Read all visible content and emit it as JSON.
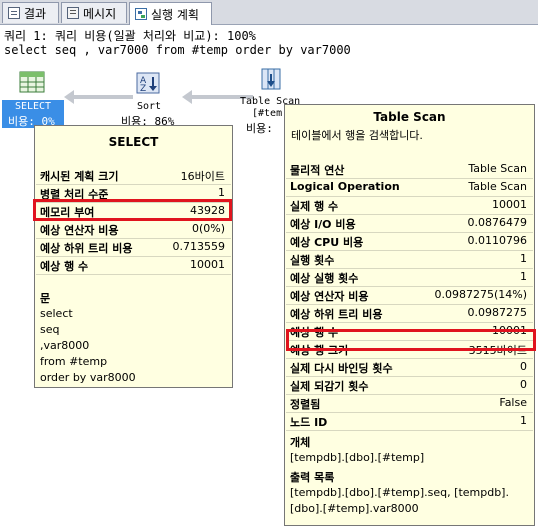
{
  "tabs": [
    {
      "label": "결과",
      "icon": "grid-icon"
    },
    {
      "label": "메시지",
      "icon": "message-icon"
    },
    {
      "label": "실행 계획",
      "icon": "execution-plan-icon"
    }
  ],
  "query": {
    "header": "쿼리 1: 쿼리 비용(일괄 처리와 비교): 100%",
    "sql": "select seq , var7000 from #temp order by var7000"
  },
  "nodes": {
    "select": {
      "label": "SELECT",
      "cost": "비용: 0%",
      "icon": "select-operator-icon"
    },
    "sort": {
      "label": "Sort",
      "cost": "비용: 86%",
      "icon": "sort-operator-icon"
    },
    "scan": {
      "label": "Table Scan",
      "sublabel": "[#tem",
      "cost": "비용: ",
      "icon": "table-scan-operator-icon"
    }
  },
  "select_tooltip": {
    "title": "SELECT",
    "rows": [
      {
        "k": "캐시된 계획 크기",
        "v": "16바이트"
      },
      {
        "k": "병렬 처리 수준",
        "v": "1"
      },
      {
        "k": "메모리 부여",
        "v": "43928"
      },
      {
        "k": "예상 연산자 비용",
        "v": "0(0%)"
      },
      {
        "k": "예상 하위 트리 비용",
        "v": "0.713559"
      },
      {
        "k": "예상 행 수",
        "v": "10001"
      }
    ],
    "stmt_label": "문",
    "stmt_lines": [
      "select",
      "seq",
      ",var8000",
      "from #temp",
      "order by var8000"
    ]
  },
  "scan_tooltip": {
    "title": "Table Scan",
    "subtitle": "테이블에서 행을 검색합니다.",
    "rows": [
      {
        "k": "물리적 연산",
        "v": "Table Scan"
      },
      {
        "k": "Logical Operation",
        "v": "Table Scan"
      },
      {
        "k": "실제 행 수",
        "v": "10001"
      },
      {
        "k": "예상 I/O 비용",
        "v": "0.0876479"
      },
      {
        "k": "예상 CPU 비용",
        "v": "0.0110796"
      },
      {
        "k": "실행 횟수",
        "v": "1"
      },
      {
        "k": "예상 실행 횟수",
        "v": "1"
      },
      {
        "k": "예상 연산자 비용",
        "v": "0.0987275(14%)"
      },
      {
        "k": "예상 하위 트리 비용",
        "v": "0.0987275"
      },
      {
        "k": "예상 행 수",
        "v": "10001"
      },
      {
        "k": "예상 행 크기",
        "v": "3515바이트"
      },
      {
        "k": "실제 다시 바인딩 횟수",
        "v": "0"
      },
      {
        "k": "실제 되감기 횟수",
        "v": "0"
      },
      {
        "k": "정렬됨",
        "v": "False"
      },
      {
        "k": "노드 ID",
        "v": "1"
      }
    ],
    "object_label": "개체",
    "object_value": "[tempdb].[dbo].[#temp]",
    "output_label": "출력 목록",
    "output_lines": [
      "[tempdb].[dbo].[#temp].seq, [tempdb].",
      "[dbo].[#temp].var8000"
    ]
  }
}
